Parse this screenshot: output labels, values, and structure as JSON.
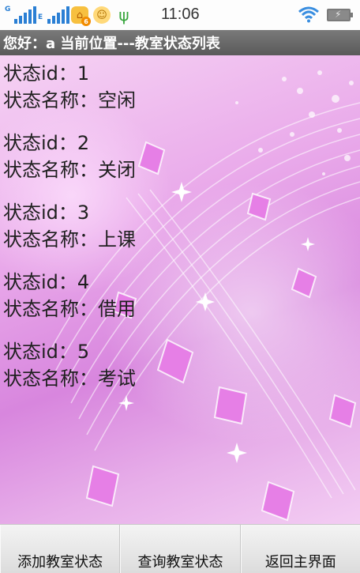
{
  "status_bar": {
    "signal_1_tag": "G",
    "signal_2_tag": "E",
    "notification_badge": "6",
    "time": "11:06"
  },
  "title_bar": {
    "text": "您好：a   当前位置---教室状态列表"
  },
  "records": [
    {
      "id_line": "状态id：1",
      "name_line": "状态名称：空闲"
    },
    {
      "id_line": "状态id：2",
      "name_line": "状态名称：关闭"
    },
    {
      "id_line": "状态id：3",
      "name_line": "状态名称：上课"
    },
    {
      "id_line": "状态id：4",
      "name_line": "状态名称：借用"
    },
    {
      "id_line": "状态id：5",
      "name_line": "状态名称：考试"
    }
  ],
  "bottom_buttons": {
    "add": "添加教室状态",
    "query": "查询教室状态",
    "back": "返回主界面"
  },
  "colors": {
    "title_bar": "#6a6a6a",
    "accent_pink": "#d886de"
  }
}
